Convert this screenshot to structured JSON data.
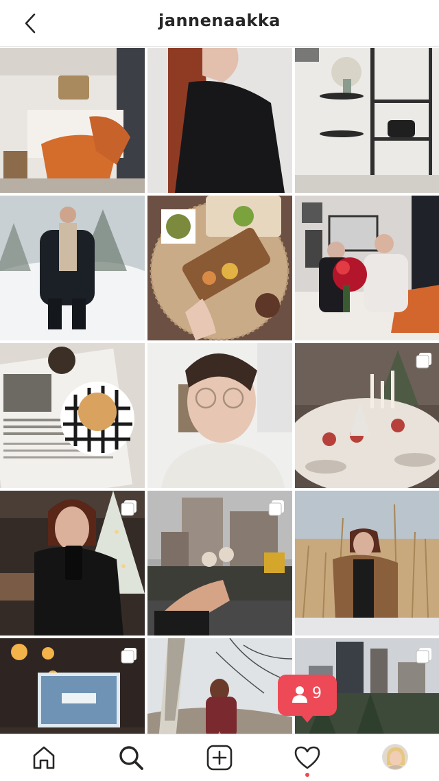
{
  "header": {
    "username": "jannenaakka",
    "back_icon": "chevron-left-icon"
  },
  "grid": {
    "posts": [
      {
        "subject": "bedroom-orange-blanket",
        "multi": false
      },
      {
        "subject": "woman-black-sweater-red-hair",
        "multi": false
      },
      {
        "subject": "shelf-decor-flowers",
        "multi": false
      },
      {
        "subject": "man-black-coat-snow",
        "multi": false
      },
      {
        "subject": "charcuterie-board",
        "multi": false
      },
      {
        "subject": "couple-roses-bedroom",
        "multi": false
      },
      {
        "subject": "newspaper-pastry-plate",
        "multi": false
      },
      {
        "subject": "man-glasses-white-hoodie",
        "multi": false
      },
      {
        "subject": "festive-table-candles",
        "multi": true
      },
      {
        "subject": "mirror-selfie-christmas-tree",
        "multi": true
      },
      {
        "subject": "cake-pops-city-street",
        "multi": true
      },
      {
        "subject": "woman-shearling-jacket-field",
        "multi": false
      },
      {
        "subject": "living-room-movie-screen",
        "multi": true
      },
      {
        "subject": "woman-bicycle-birch-tree",
        "multi": false
      },
      {
        "subject": "city-ice-rink-skyline",
        "multi": true
      }
    ]
  },
  "notification": {
    "count": "9",
    "icon": "person-icon",
    "color": "#ed4956"
  },
  "tabbar": {
    "items": [
      "home-icon",
      "search-icon",
      "add-post-icon",
      "heart-icon",
      "profile-avatar"
    ],
    "active": "search-icon"
  }
}
